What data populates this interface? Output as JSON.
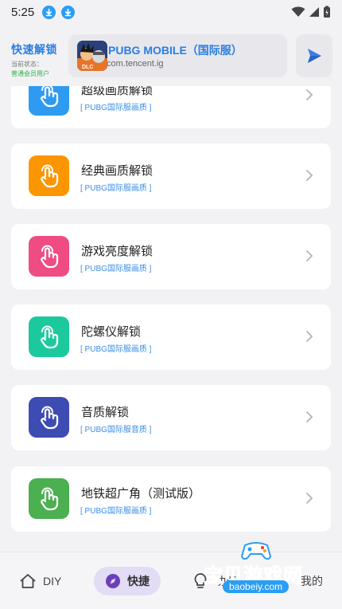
{
  "status_bar": {
    "time": "5:25"
  },
  "header": {
    "brand_title": "快速解锁",
    "status_label": "当前状态：",
    "member_label": "普通会员用户",
    "game_name": "PUBG MOBILE（国际服）",
    "game_package": "com.tencent.ig",
    "game_icon_caption": "DLC"
  },
  "cards": [
    {
      "title": "超级画质解锁",
      "subtitle": "[ PUBG国际服画质 ]",
      "color": "#2f9af2"
    },
    {
      "title": "经典画质解锁",
      "subtitle": "[ PUBG国际服画质 ]",
      "color": "#fb9600"
    },
    {
      "title": "游戏亮度解锁",
      "subtitle": "[ PUBG国际服画质 ]",
      "color": "#ee4c82"
    },
    {
      "title": "陀螺仪解锁",
      "subtitle": "[ PUBG国际服画质 ]",
      "color": "#1cc99d"
    },
    {
      "title": "音质解锁",
      "subtitle": "[ PUBG国际服音质 ]",
      "color": "#3d4bb2"
    },
    {
      "title": "地铁超广角（测试版）",
      "subtitle": "[ PUBG国际服画质 ]",
      "color": "#4caf50"
    }
  ],
  "bottom_nav": {
    "diy": "DIY",
    "quick": "快捷",
    "func": "功能",
    "mine": "我的"
  },
  "watermark": {
    "text": "宝贝游戏网",
    "url": "baobeiy.com"
  },
  "colors": {
    "accent": "#2a7de1",
    "active_nav_bg": "#e3dcf5"
  }
}
